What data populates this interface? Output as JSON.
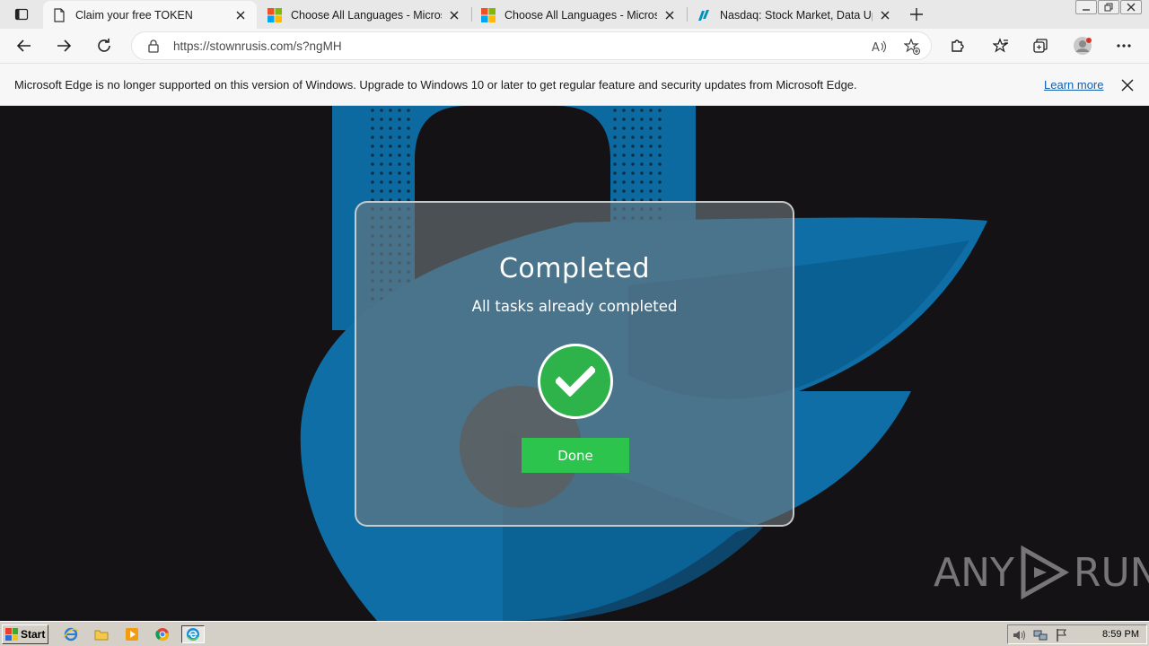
{
  "tabs": [
    {
      "title": "Claim your free TOKEN",
      "icon": "page-icon",
      "active": true
    },
    {
      "title": "Choose All Languages - Microsoft",
      "icon": "microsoft-logo-icon",
      "active": false
    },
    {
      "title": "Choose All Languages - Microsoft",
      "icon": "microsoft-logo-icon",
      "active": false
    },
    {
      "title": "Nasdaq: Stock Market, Data Updates",
      "icon": "nasdaq-logo-icon",
      "active": false
    }
  ],
  "address_bar": {
    "url": "https://stownrusis.com/s?ngMH"
  },
  "infobar": {
    "message": "Microsoft Edge is no longer supported on this version of Windows. Upgrade to Windows 10 or later to get regular feature and security updates from Microsoft Edge.",
    "link_label": "Learn more"
  },
  "modal": {
    "title": "Completed",
    "subtitle": "All tasks already completed",
    "button_label": "Done"
  },
  "watermark": {
    "left": "ANY",
    "right": "RUN"
  },
  "taskbar": {
    "start_label": "Start",
    "clock": "8:59 PM"
  },
  "colors": {
    "accent_green": "#2cc44c",
    "background_blue": "#0f6fa8",
    "link_blue": "#0f5fb5"
  }
}
